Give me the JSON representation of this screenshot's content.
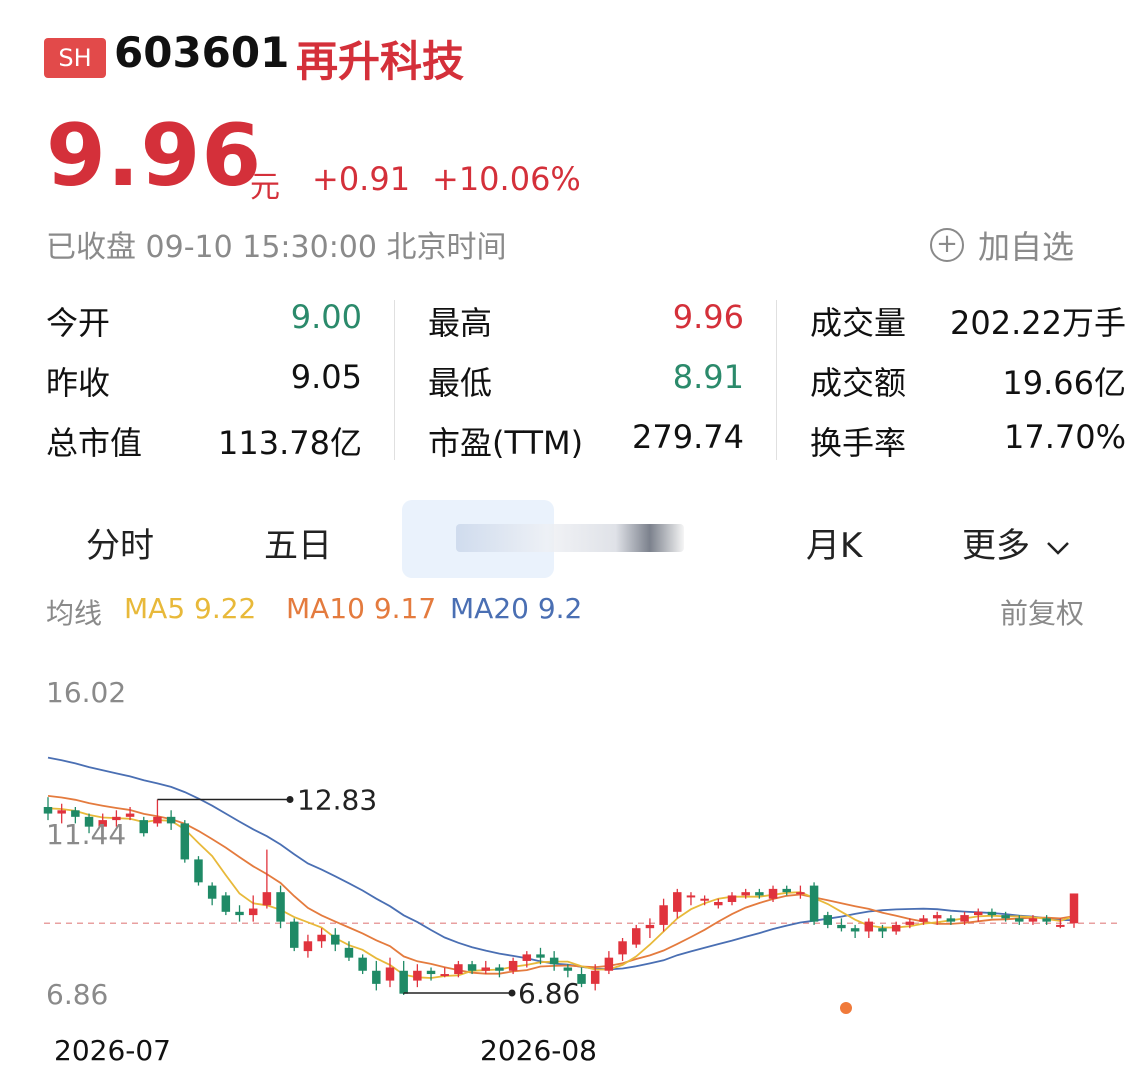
{
  "header": {
    "exchange": "SH",
    "code": "603601",
    "name": "再升科技"
  },
  "quote": {
    "price": "9.96",
    "unit": "元",
    "change": "+0.91",
    "change_pct": "+10.06%",
    "status": "已收盘 09-10 15:30:00 北京时间",
    "watch_label": "加自选"
  },
  "stats": {
    "col1": [
      {
        "label": "今开",
        "value": "9.00"
      },
      {
        "label": "昨收",
        "value": "9.05"
      },
      {
        "label": "总市值",
        "value": "113.78亿"
      }
    ],
    "col2": [
      {
        "label": "最高",
        "value": "9.96"
      },
      {
        "label": "最低",
        "value": "8.91"
      },
      {
        "label": "市盈(TTM)",
        "value": "279.74"
      }
    ],
    "col3": [
      {
        "label": "成交量",
        "value": "202.22万手"
      },
      {
        "label": "成交额",
        "value": "19.66亿"
      },
      {
        "label": "换手率",
        "value": "17.70%"
      }
    ]
  },
  "tabs": [
    "分时",
    "五日",
    "",
    "月K",
    "更多"
  ],
  "ma": {
    "label": "均线",
    "ma5": "MA5 9.22",
    "ma10": "MA10 9.17",
    "ma20": "MA20 9.2",
    "adjust": "前复权",
    "colors": {
      "ma5": "#e8b93a",
      "ma10": "#e47b3e",
      "ma20": "#4a6fb3"
    }
  },
  "chart_data": {
    "type": "candlestick",
    "y_labels": [
      "16.02",
      "11.44",
      "6.86"
    ],
    "x_labels": [
      "2026-07",
      "2026-08"
    ],
    "annotations": {
      "high": "12.83",
      "low": "6.86"
    },
    "reference_price": 9.05,
    "candles": [
      [
        12.6,
        12.4,
        12.9,
        12.2
      ],
      [
        12.4,
        12.5,
        12.7,
        12.1
      ],
      [
        12.5,
        12.3,
        12.6,
        12.1
      ],
      [
        12.3,
        12.0,
        12.4,
        11.8
      ],
      [
        12.0,
        12.2,
        12.4,
        11.9
      ],
      [
        12.2,
        12.3,
        12.5,
        12.0
      ],
      [
        12.3,
        12.4,
        12.6,
        12.2
      ],
      [
        12.2,
        11.8,
        12.3,
        11.7
      ],
      [
        12.1,
        12.3,
        12.83,
        12.0
      ],
      [
        12.3,
        12.1,
        12.5,
        11.9
      ],
      [
        12.1,
        11.0,
        12.2,
        10.9
      ],
      [
        11.0,
        10.3,
        11.1,
        10.2
      ],
      [
        10.2,
        9.8,
        10.3,
        9.6
      ],
      [
        9.9,
        9.4,
        10.0,
        9.3
      ],
      [
        9.4,
        9.3,
        9.6,
        9.1
      ],
      [
        9.3,
        9.5,
        9.9,
        9.1
      ],
      [
        9.6,
        10.0,
        11.3,
        9.5
      ],
      [
        10.0,
        9.1,
        10.2,
        8.9
      ],
      [
        9.1,
        8.3,
        9.2,
        8.2
      ],
      [
        8.2,
        8.5,
        8.7,
        8.0
      ],
      [
        8.5,
        8.7,
        8.9,
        8.3
      ],
      [
        8.7,
        8.4,
        8.9,
        8.2
      ],
      [
        8.3,
        8.0,
        8.5,
        7.9
      ],
      [
        8.0,
        7.6,
        8.1,
        7.5
      ],
      [
        7.6,
        7.2,
        7.9,
        7.0
      ],
      [
        7.3,
        7.7,
        8.0,
        7.1
      ],
      [
        7.6,
        6.9,
        7.9,
        6.86
      ],
      [
        7.3,
        7.6,
        7.8,
        7.1
      ],
      [
        7.6,
        7.5,
        7.7,
        7.3
      ],
      [
        7.5,
        7.5,
        7.7,
        7.4
      ],
      [
        7.5,
        7.8,
        7.9,
        7.4
      ],
      [
        7.8,
        7.6,
        7.9,
        7.5
      ],
      [
        7.6,
        7.7,
        7.9,
        7.5
      ],
      [
        7.7,
        7.6,
        7.8,
        7.4
      ],
      [
        7.6,
        7.9,
        8.0,
        7.5
      ],
      [
        7.9,
        8.1,
        8.2,
        7.7
      ],
      [
        8.1,
        8.0,
        8.3,
        7.8
      ],
      [
        8.0,
        7.8,
        8.2,
        7.6
      ],
      [
        7.7,
        7.6,
        7.8,
        7.4
      ],
      [
        7.5,
        7.2,
        7.7,
        7.1
      ],
      [
        7.2,
        7.6,
        7.8,
        7.0
      ],
      [
        7.6,
        8.0,
        8.2,
        7.5
      ],
      [
        8.1,
        8.5,
        8.6,
        7.9
      ],
      [
        8.4,
        8.9,
        9.0,
        8.3
      ],
      [
        8.9,
        9.0,
        9.2,
        8.6
      ],
      [
        9.0,
        9.6,
        9.8,
        8.8
      ],
      [
        9.4,
        10.0,
        10.1,
        9.2
      ],
      [
        9.9,
        9.9,
        10.0,
        9.6
      ],
      [
        9.8,
        9.8,
        9.9,
        9.6
      ],
      [
        9.6,
        9.7,
        9.8,
        9.5
      ],
      [
        9.7,
        9.9,
        10.0,
        9.6
      ],
      [
        9.9,
        10.0,
        10.1,
        9.8
      ],
      [
        10.0,
        9.9,
        10.1,
        9.8
      ],
      [
        9.8,
        10.1,
        10.2,
        9.7
      ],
      [
        10.1,
        10.0,
        10.2,
        9.9
      ],
      [
        10.0,
        10.0,
        10.2,
        9.8
      ],
      [
        10.2,
        9.1,
        10.3,
        9.0
      ],
      [
        9.3,
        9.0,
        9.4,
        8.9
      ],
      [
        9.0,
        8.9,
        9.2,
        8.8
      ],
      [
        8.9,
        8.8,
        9.0,
        8.6
      ],
      [
        8.8,
        9.1,
        9.2,
        8.6
      ],
      [
        8.9,
        8.8,
        9.0,
        8.6
      ],
      [
        8.8,
        9.0,
        9.1,
        8.7
      ],
      [
        9.0,
        9.1,
        9.2,
        8.9
      ],
      [
        9.1,
        9.2,
        9.3,
        9.0
      ],
      [
        9.2,
        9.3,
        9.4,
        9.0
      ],
      [
        9.2,
        9.1,
        9.3,
        9.0
      ],
      [
        9.1,
        9.3,
        9.4,
        9.0
      ],
      [
        9.3,
        9.4,
        9.5,
        9.1
      ],
      [
        9.4,
        9.3,
        9.5,
        9.2
      ],
      [
        9.3,
        9.2,
        9.4,
        9.1
      ],
      [
        9.2,
        9.1,
        9.3,
        9.0
      ],
      [
        9.1,
        9.2,
        9.3,
        9.0
      ],
      [
        9.2,
        9.1,
        9.3,
        9.0
      ],
      [
        9.0,
        9.0,
        9.2,
        8.9
      ],
      [
        9.05,
        9.96,
        9.96,
        8.91
      ]
    ]
  }
}
